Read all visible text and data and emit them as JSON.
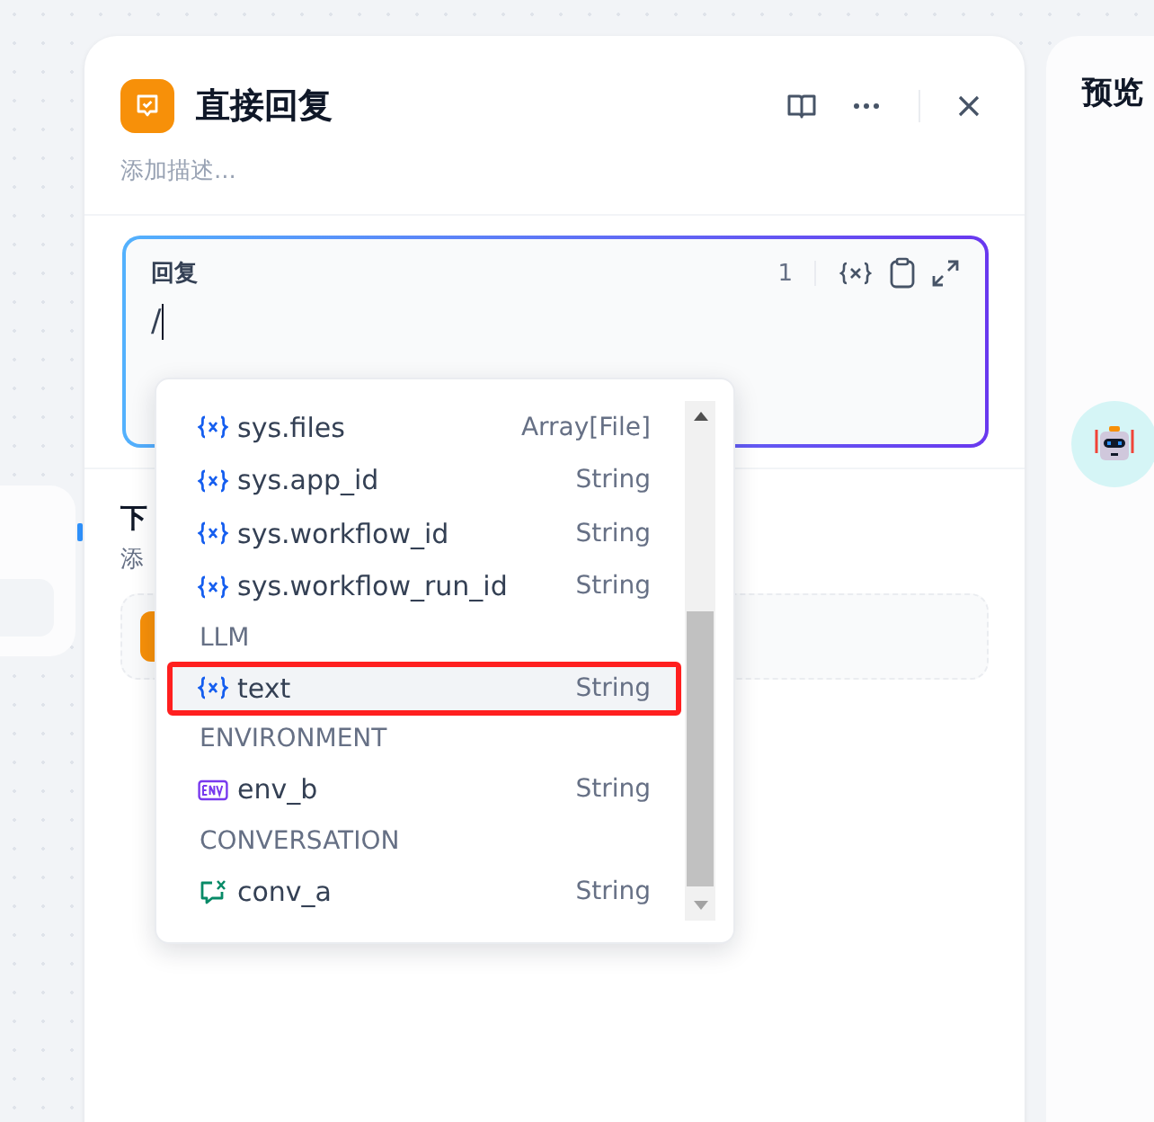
{
  "panel": {
    "title": "直接回复",
    "description_placeholder": "添加描述...",
    "reply": {
      "label": "回复",
      "count": "1",
      "value": "/"
    },
    "next_step": {
      "title": "下",
      "description": "添"
    }
  },
  "dropdown": {
    "items": [
      {
        "kind": "variable",
        "name": "sys.files",
        "type": "Array[File]",
        "selected": false
      },
      {
        "kind": "variable",
        "name": "sys.app_id",
        "type": "String",
        "selected": false
      },
      {
        "kind": "variable",
        "name": "sys.workflow_id",
        "type": "String",
        "selected": false
      },
      {
        "kind": "variable",
        "name": "sys.workflow_run_id",
        "type": "String",
        "selected": false
      },
      {
        "kind": "heading",
        "name": "LLM"
      },
      {
        "kind": "variable",
        "name": "text",
        "type": "String",
        "selected": true
      },
      {
        "kind": "heading",
        "name": "ENVIRONMENT"
      },
      {
        "kind": "environment",
        "name": "env_b",
        "type": "String",
        "selected": false
      },
      {
        "kind": "heading",
        "name": "CONVERSATION"
      },
      {
        "kind": "conversation",
        "name": "conv_a",
        "type": "String",
        "selected": false
      }
    ]
  },
  "preview": {
    "title": "预览"
  }
}
